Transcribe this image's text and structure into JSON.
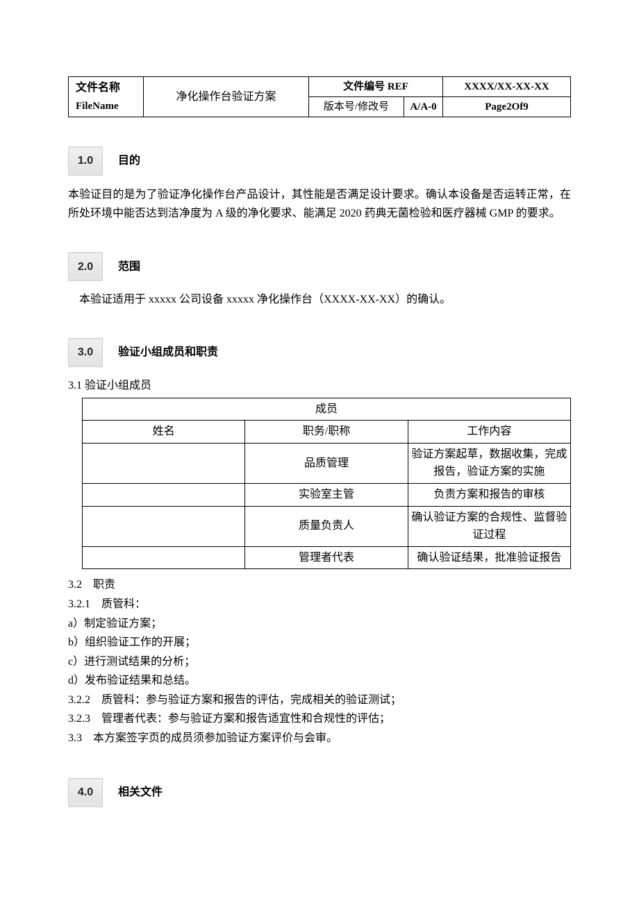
{
  "header": {
    "file_label_zh": "文件名称",
    "file_label_en": "FileName",
    "title": "净化操作台验证方案",
    "ref_label": "文件编号 REF",
    "ref_value": "XXXX/XX-XX-XX",
    "version_label": "版本号/修改号",
    "version_value": "A/A-0",
    "page": "Page2Of9"
  },
  "sections": {
    "s1": {
      "num": "1.0",
      "title": "目的",
      "para": "本验证目的是为了验证净化操作台产品设计，其性能是否满足设计要求。确认本设备是否运转正常，在所处环境中能否达到洁净度为 A 级的净化要求、能满足 2020 药典无菌检验和医疗器械 GMP 的要求。"
    },
    "s2": {
      "num": "2.0",
      "title": "范围",
      "para": "本验证适用于 xxxxx 公司设备 xxxxx 净化操作台（XXXX-XX-XX）的确认。"
    },
    "s3": {
      "num": "3.0",
      "title": "验证小组成员和职责"
    },
    "s4": {
      "num": "4.0",
      "title": "相关文件"
    }
  },
  "members": {
    "subheading": "3.1 验证小组成员",
    "table": {
      "caption": "成员",
      "cols": [
        "姓名",
        "职务/职称",
        "工作内容"
      ],
      "rows": [
        {
          "name": "",
          "role": "品质管理",
          "work": "验证方案起草，数据收集，完成报告，验证方案的实施"
        },
        {
          "name": "",
          "role": "实验室主管",
          "work": "负责方案和报告的审核"
        },
        {
          "name": "",
          "role": "质量负责人",
          "work": "确认验证方案的合规性、监督验证过程"
        },
        {
          "name": "",
          "role": "管理者代表",
          "work": "确认验证结果，批准验证报告"
        }
      ]
    }
  },
  "duties": {
    "heading32": "3.2　职责",
    "heading321": "3.2.1　质管科：",
    "items321": [
      "a）制定验证方案；",
      "b）组织验证工作的开展；",
      "c）进行测试结果的分析；",
      "d）发布验证结果和总结。"
    ],
    "line322": "3.2.2　质管科：参与验证方案和报告的评估，完成相关的验证测试；",
    "line323": "3.2.3　管理者代表：参与验证方案和报告适宜性和合规性的评估；",
    "line33": "3.3　本方案签字页的成员须参加验证方案评价与会审。"
  }
}
